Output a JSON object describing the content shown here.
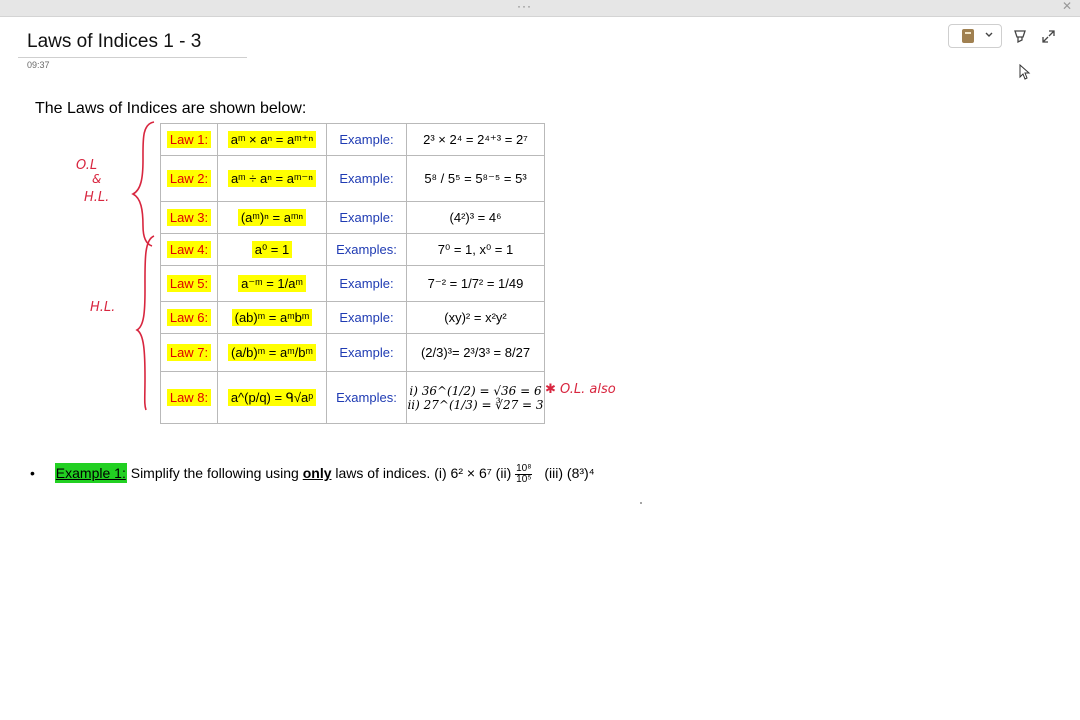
{
  "page": {
    "title": "Laws of Indices 1 - 3",
    "time": "09:37"
  },
  "intro": "The Laws of Indices are shown below:",
  "table": {
    "rows": [
      {
        "law": "Law 1:",
        "formula": "aᵐ × aⁿ = aᵐ⁺ⁿ",
        "label": "Example:",
        "example": "2³ × 2⁴ = 2⁴⁺³ = 2⁷"
      },
      {
        "law": "Law 2:",
        "formula": "aᵐ ÷ aⁿ = aᵐ⁻ⁿ",
        "label": "Example:",
        "example": "5⁸ / 5⁵ = 5⁸⁻⁵ = 5³"
      },
      {
        "law": "Law 3:",
        "formula": "(aᵐ)ⁿ = aᵐⁿ",
        "label": "Example:",
        "example": "(4²)³ = 4⁶"
      },
      {
        "law": "Law 4:",
        "formula": "a⁰ = 1",
        "label": "Examples:",
        "example": "7⁰ = 1, x⁰ = 1"
      },
      {
        "law": "Law 5:",
        "formula": "a⁻ᵐ = 1/aᵐ",
        "label": "Example:",
        "example": "7⁻² = 1/7² = 1/49"
      },
      {
        "law": "Law 6:",
        "formula": "(ab)ᵐ = aᵐbᵐ",
        "label": "Example:",
        "example": "(xy)² = x²y²"
      },
      {
        "law": "Law 7:",
        "formula": "(a/b)ᵐ = aᵐ/bᵐ",
        "label": "Example:",
        "example": "(2/3)³= 2³/3³ = 8/27"
      },
      {
        "law": "Law 8:",
        "formula": "a^(p/q) = ᑫ√aᵖ",
        "label": "Examples:",
        "example1": "i) 36^(1/2) = √36 = 6",
        "example2": "ii) 27^(1/3) = ∛27 = 3"
      }
    ]
  },
  "annotations": {
    "ol_hl_top": "O.L",
    "ampersand": "&",
    "hl_top": "H.L.",
    "hl_bottom": "H.L.",
    "ol_also": "✱ O.L. also"
  },
  "example1": {
    "tag": "Example 1:",
    "text_before": "Simplify the following using",
    "bold": "only",
    "text_after": "laws of indices. (i) 6² × 6⁷  (ii)",
    "frac_num": "10⁸",
    "frac_den": "10⁵",
    "part3": "(iii) (8³)⁴"
  },
  "colors": {
    "law_red": "#e00000",
    "label_blue": "#1f3bb3",
    "highlight_yellow": "#ffff00",
    "highlight_green": "#22d022",
    "ink_red": "#d8263f"
  },
  "icons": [
    "notebook-icon",
    "chevron-down-icon",
    "highlighter-icon",
    "expand-icon",
    "close-icon",
    "more-icon",
    "cursor-icon"
  ]
}
